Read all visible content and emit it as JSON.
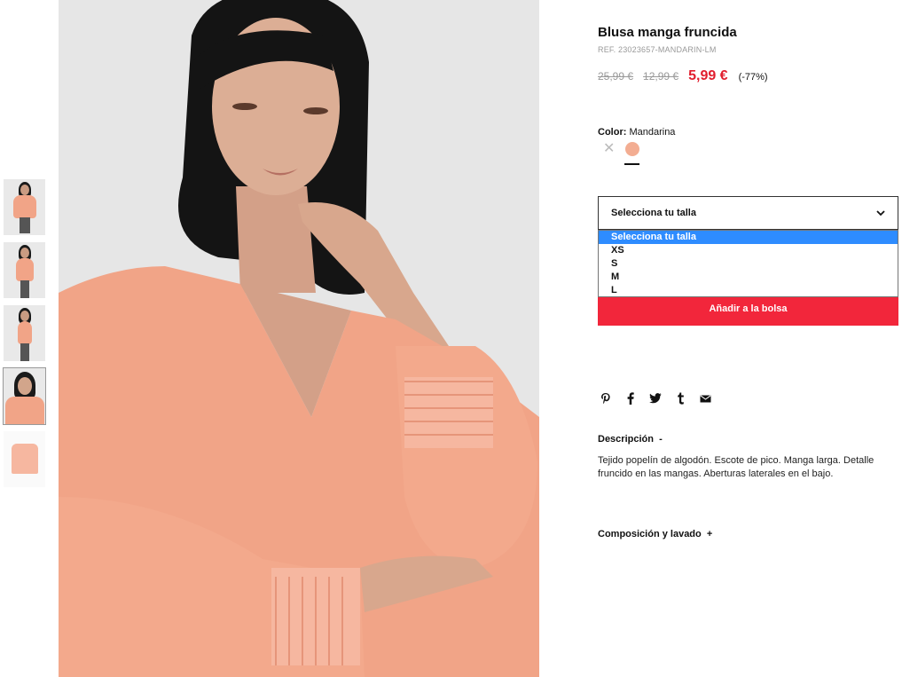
{
  "product": {
    "title": "Blusa manga fruncida",
    "ref": "REF. 23023657-MANDARIN-LM",
    "price_original": "25,99 €",
    "price_previous": "12,99 €",
    "price_current": "5,99 €",
    "discount": "(-77%)"
  },
  "color": {
    "label": "Color:",
    "value": "Mandarina",
    "swatch_color": "#f3ad92"
  },
  "size": {
    "select_label": "Selecciona tu talla",
    "options": [
      "Selecciona tu talla",
      "XS",
      "S",
      "M",
      "L"
    ],
    "selected_index": 0
  },
  "actions": {
    "add_to_bag": "Añadir a la bolsa"
  },
  "share": {
    "icons": [
      "pinterest-icon",
      "facebook-icon",
      "twitter-icon",
      "tumblr-icon",
      "email-icon"
    ]
  },
  "description": {
    "heading": "Descripción  -",
    "text": "Tejido popelín de algodón. Escote de pico. Manga larga. Detalle fruncido en las mangas. Aberturas laterales en el bajo."
  },
  "composition": {
    "heading": "Composición y lavado  +"
  },
  "colors": {
    "accent_red": "#e11e2e",
    "button_red": "#f2263b",
    "select_highlight": "#2e8cff",
    "blouse": "#f1a487"
  }
}
